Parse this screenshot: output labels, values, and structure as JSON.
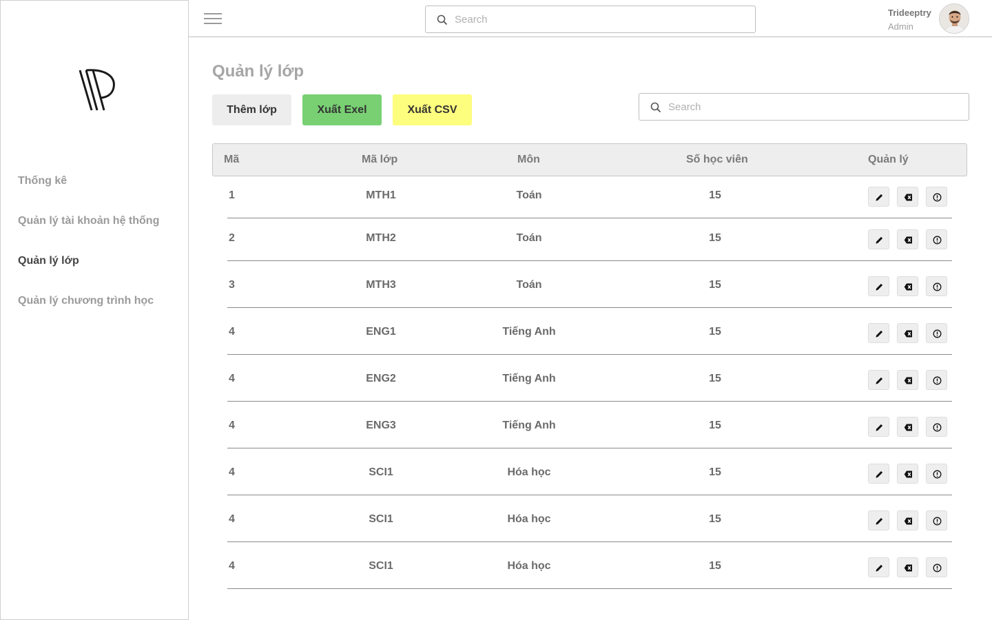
{
  "sidebar": {
    "items": [
      {
        "label": "Thống kê",
        "active": false
      },
      {
        "label": "Quản lý tài khoản hệ thống",
        "active": false
      },
      {
        "label": "Quản lý lớp",
        "active": true
      },
      {
        "label": "Quản lý chương trình học",
        "active": false
      }
    ]
  },
  "topbar": {
    "search_placeholder": "Search",
    "user_name": "Trideeptry",
    "user_role": "Admin"
  },
  "main": {
    "title": "Quản lý lớp",
    "buttons": {
      "add": "Thêm lớp",
      "export_excel": "Xuất Exel",
      "export_csv": "Xuất CSV"
    },
    "search_placeholder": "Search",
    "table": {
      "headers": [
        "Mã",
        "Mã lớp",
        "Môn",
        "Số học viên",
        "Quản lý"
      ],
      "rows": [
        {
          "ma": "1",
          "ma_lop": "MTH1",
          "mon": "Toán",
          "so_hoc_vien": "15"
        },
        {
          "ma": "2",
          "ma_lop": "MTH2",
          "mon": "Toán",
          "so_hoc_vien": "15"
        },
        {
          "ma": "3",
          "ma_lop": "MTH3",
          "mon": "Toán",
          "so_hoc_vien": "15"
        },
        {
          "ma": "4",
          "ma_lop": "ENG1",
          "mon": "Tiếng Anh",
          "so_hoc_vien": "15"
        },
        {
          "ma": "4",
          "ma_lop": "ENG2",
          "mon": "Tiếng Anh",
          "so_hoc_vien": "15"
        },
        {
          "ma": "4",
          "ma_lop": "ENG3",
          "mon": "Tiếng Anh",
          "so_hoc_vien": "15"
        },
        {
          "ma": "4",
          "ma_lop": "SCI1",
          "mon": "Hóa học",
          "so_hoc_vien": "15"
        },
        {
          "ma": "4",
          "ma_lop": "SCI1",
          "mon": "Hóa học",
          "so_hoc_vien": "15"
        },
        {
          "ma": "4",
          "ma_lop": "SCI1",
          "mon": "Hóa học",
          "so_hoc_vien": "15"
        }
      ],
      "row_actions": [
        "pencil-icon",
        "delete-icon",
        "info-icon"
      ]
    }
  },
  "colors": {
    "export_excel": "#78d073",
    "export_csv": "#fdfd7e",
    "add_button": "#ededed",
    "table_header": "#eeeeee"
  }
}
